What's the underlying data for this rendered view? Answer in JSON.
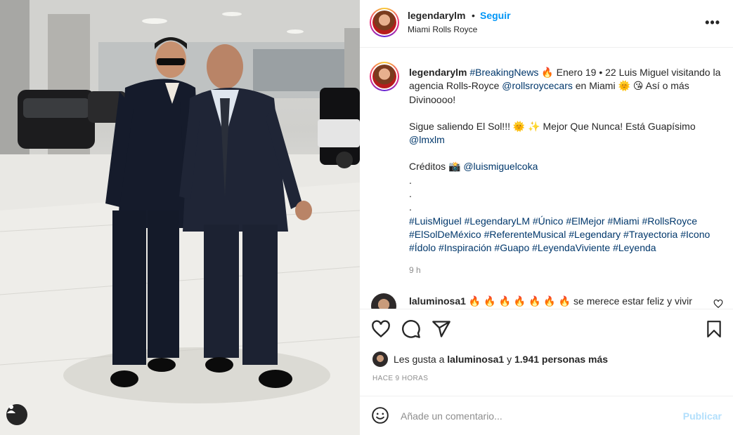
{
  "header": {
    "username": "legendarylm",
    "separator": "•",
    "follow_label": "Seguir",
    "location": "Miami Rolls Royce",
    "more_label": "•••"
  },
  "caption": {
    "username": "legendarylm",
    "lines": [
      [
        "#BreakingNews",
        " 🔥 Enero 19 • 22 Luis Miguel visitando la agencia Rolls-Royce ",
        "@rollsroycecars",
        " en Miami 🌞 😘 Así o más Divinoooo!"
      ],
      [
        "Sigue saliendo El Sol!!! 🌞 ✨ Mejor Que Nunca! Está Guapísimo ",
        "@lmxlm"
      ],
      [
        "Créditos 📸 ",
        "@luismiguelcoka"
      ]
    ],
    "dots": [
      ".",
      ".",
      "."
    ],
    "hashtags": "#LuisMiguel #LegendaryLM #Único #ElMejor #Miami #RollsRoyce #ElSolDeMéxico #ReferenteMusical #Legendary #Trayectoria #Icono #Ídolo #Inspiración #Guapo #LeyendaViviente #Leyenda",
    "time_ago": "9 h"
  },
  "comment": {
    "username": "laluminosa1",
    "text": "🔥 🔥 🔥 🔥 🔥 🔥 🔥  se merece estar feliz y vivir"
  },
  "likes": {
    "prefix": "Les gusta a",
    "user": "laluminosa1",
    "conj": "y",
    "others": "1.941 personas más"
  },
  "timestamp": "HACE 9 HORAS",
  "add_comment": {
    "placeholder": "Añade un comentario...",
    "publish_label": "Publicar"
  },
  "icons": {
    "like": "heart-icon",
    "comment": "comment-icon",
    "share": "share-icon",
    "save": "bookmark-icon",
    "emoji": "emoji-icon",
    "tag": "user-tag-icon"
  },
  "colors": {
    "link": "#0095f6",
    "hashtag": "#00376b",
    "muted": "#8e8e8e",
    "publish_disabled": "#b2dffc"
  }
}
